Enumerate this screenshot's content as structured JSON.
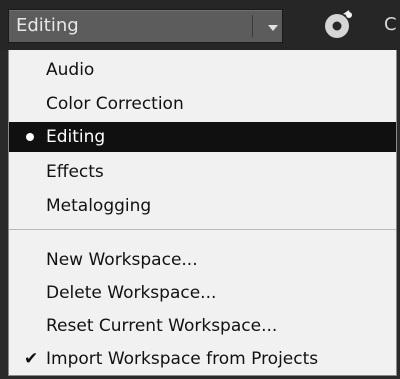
{
  "workspace_selector": {
    "selected_label": "Editing",
    "arrow_icon": "chevron-down-icon"
  },
  "toolbar": {
    "tool_icon": "settings-gear-icon",
    "clipped_label": "C"
  },
  "menu": {
    "workspaces": [
      {
        "label": "Audio",
        "selected": false
      },
      {
        "label": "Color Correction",
        "selected": false
      },
      {
        "label": "Editing",
        "selected": true
      },
      {
        "label": "Effects",
        "selected": false
      },
      {
        "label": "Metalogging",
        "selected": false
      }
    ],
    "actions": [
      {
        "label": "New Workspace...",
        "checked": false
      },
      {
        "label": "Delete Workspace...",
        "checked": false
      },
      {
        "label": "Reset Current Workspace...",
        "checked": false
      },
      {
        "label": "Import Workspace from Projects",
        "checked": true
      }
    ]
  },
  "colors": {
    "toolbar_bg": "#262626",
    "selector_bg": "#5c5c5c",
    "menu_bg": "#f1f1f1",
    "selected_bg": "#101010"
  }
}
